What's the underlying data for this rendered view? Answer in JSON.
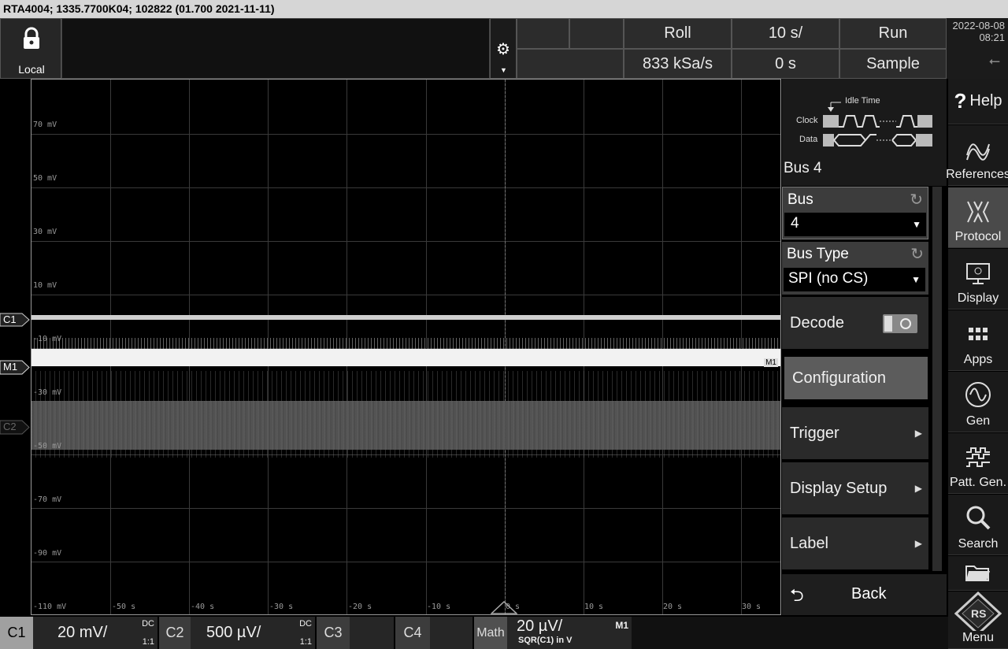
{
  "title_bar": "RTA4004; 1335.7700K04; 102822 (01.700 2021-11-11)",
  "top": {
    "lock_label": "Local",
    "acq_mode": "Roll",
    "timebase": "10 s/",
    "run_state": "Run",
    "sample_rate": "833 kSa/s",
    "position": "0 s",
    "acq_type": "Sample"
  },
  "datetime": {
    "date": "2022-08-08",
    "time": "08:21"
  },
  "grid": {
    "y_labels": [
      "70 mV",
      "50 mV",
      "30 mV",
      "10 mV",
      "-10 mV",
      "-30 mV",
      "-50 mV",
      "-70 mV",
      "-90 mV",
      "-110 mV"
    ],
    "x_labels": [
      "-50 s",
      "-40 s",
      "-30 s",
      "-20 s",
      "-10 s",
      "0 s",
      "10 s",
      "20 s",
      "30 s"
    ]
  },
  "markers": {
    "c1": "C1",
    "m1": "M1",
    "c2": "C2",
    "m1_right": "M1"
  },
  "panel": {
    "diagram": {
      "idle_time": "Idle Time",
      "clock": "Clock",
      "data": "Data"
    },
    "header": "Bus 4",
    "bus_label": "Bus",
    "bus_value": "4",
    "bus_type_label": "Bus Type",
    "bus_type_value": "SPI (no CS)",
    "decode_label": "Decode",
    "configuration": "Configuration",
    "trigger": "Trigger",
    "display_setup": "Display Setup",
    "label": "Label",
    "back": "Back"
  },
  "nav": {
    "help": "Help",
    "references": "References",
    "protocol": "Protocol",
    "display": "Display",
    "apps": "Apps",
    "gen": "Gen",
    "patt_gen": "Patt. Gen.",
    "search": "Search",
    "menu": "Menu"
  },
  "bottom": {
    "c1": {
      "name": "C1",
      "scale": "20 mV/",
      "coupling": "DC",
      "ratio": "1:1"
    },
    "c2": {
      "name": "C2",
      "scale": "500 µV/",
      "coupling": "DC",
      "ratio": "1:1"
    },
    "c3": {
      "name": "C3"
    },
    "c4": {
      "name": "C4"
    },
    "math": {
      "name": "Math",
      "scale": "20 µV/",
      "expr": "SQR(C1) in V",
      "tag": "M1"
    }
  },
  "colors": {
    "accent_active": "#4a4a4a",
    "trace_c1": "#d8d8d8",
    "trace_m1": "#f2f2f2",
    "trace_c2": "#5a5a5a"
  }
}
